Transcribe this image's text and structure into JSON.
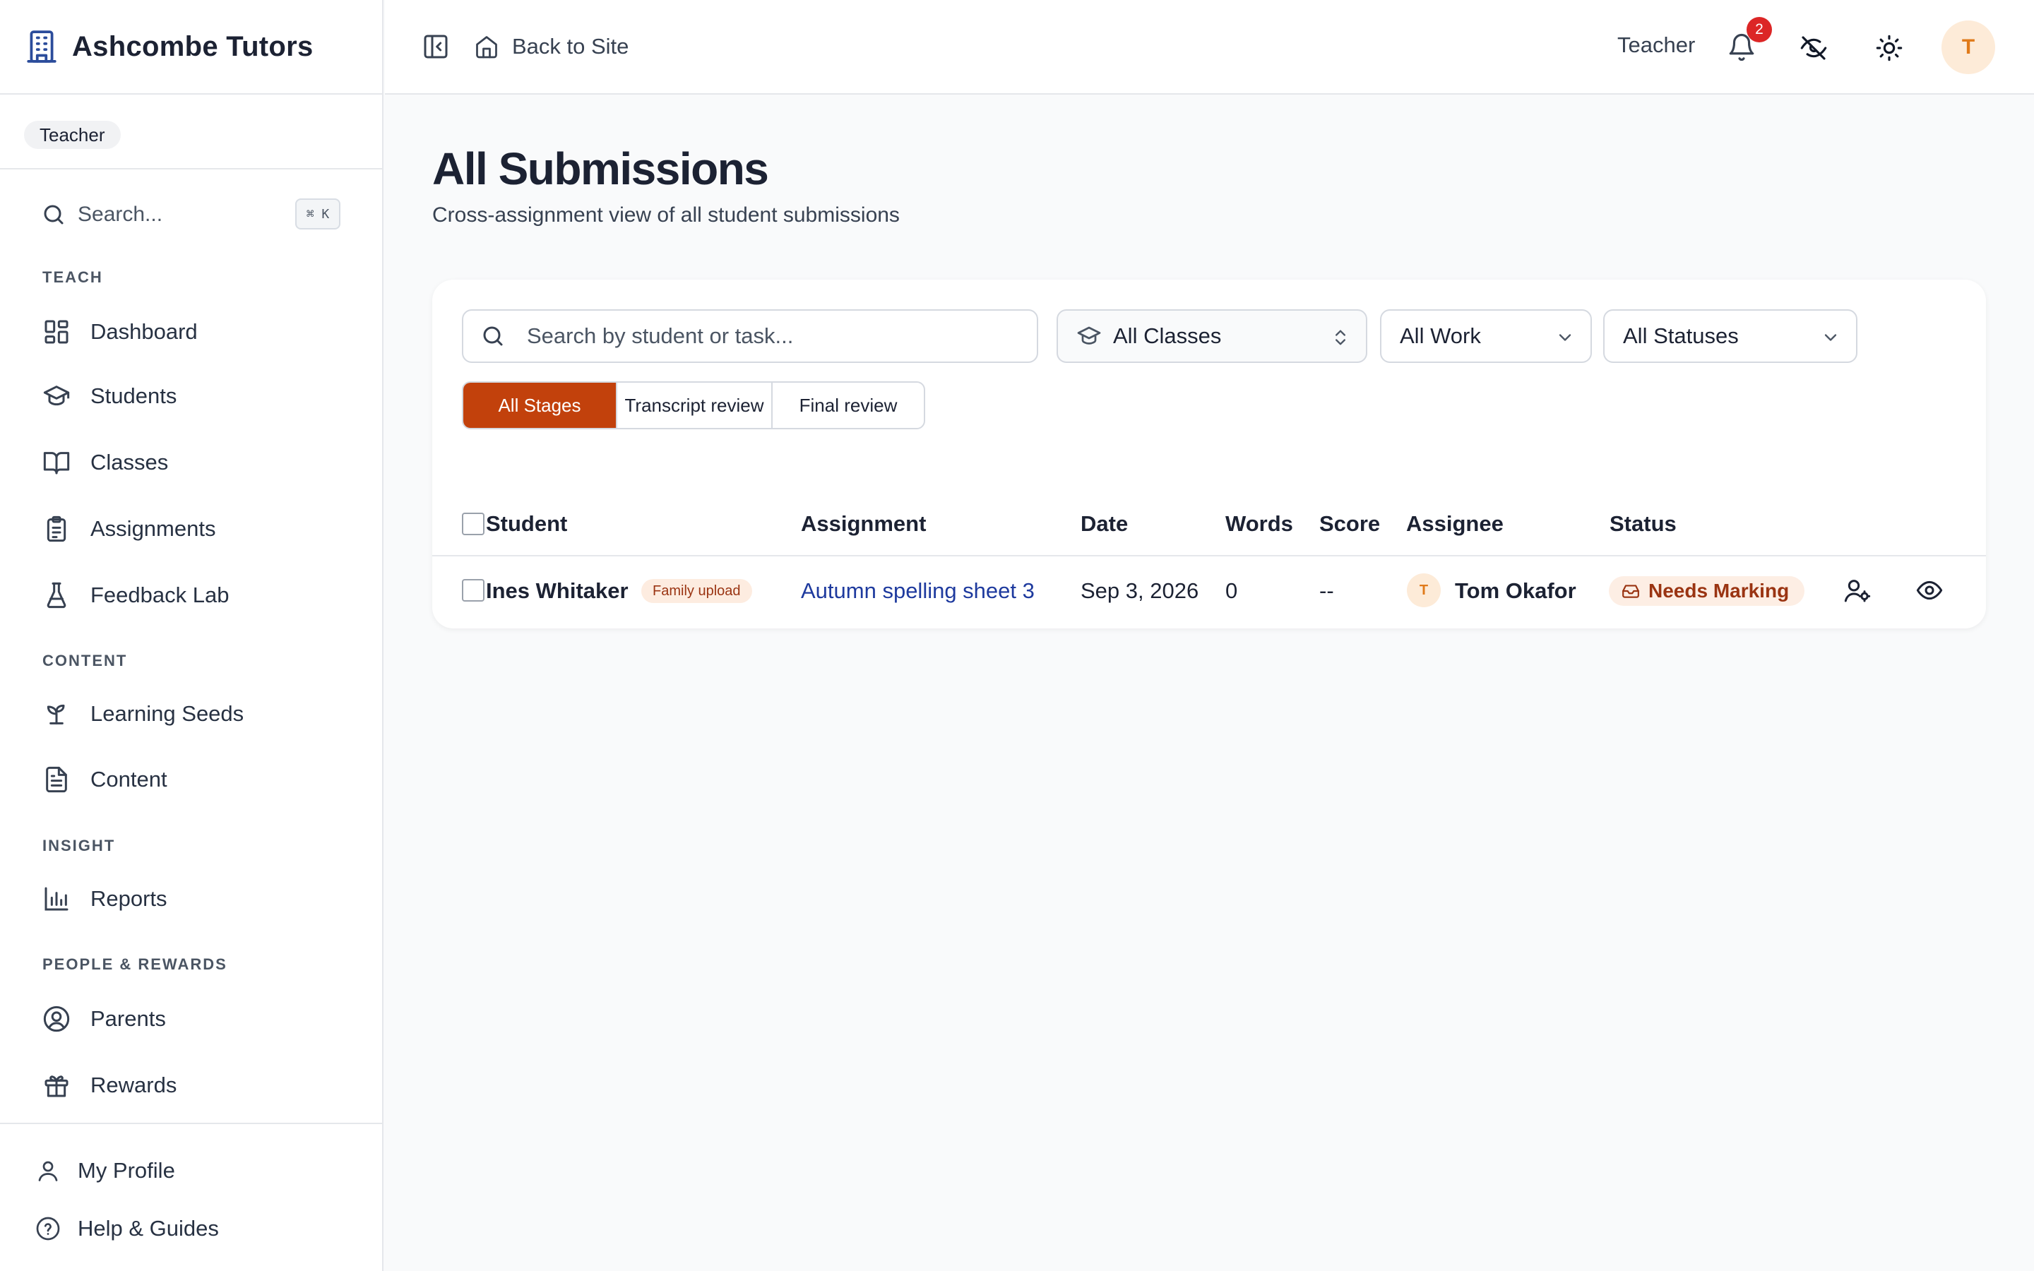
{
  "brand": {
    "name": "Ashcombe Tutors",
    "icon": "building-icon"
  },
  "sidebar": {
    "role_chip": "Teacher",
    "search": {
      "placeholder": "Search...",
      "shortcut": "⌘ K"
    },
    "sections": [
      {
        "label": "TEACH",
        "items": [
          {
            "label": "Dashboard",
            "icon": "dashboard-icon"
          },
          {
            "label": "Students",
            "icon": "graduation-cap-icon"
          },
          {
            "label": "Classes",
            "icon": "book-open-icon"
          },
          {
            "label": "Assignments",
            "icon": "clipboard-list-icon"
          },
          {
            "label": "Feedback Lab",
            "icon": "flask-icon"
          }
        ]
      },
      {
        "label": "CONTENT",
        "items": [
          {
            "label": "Learning Seeds",
            "icon": "sprout-icon"
          },
          {
            "label": "Content",
            "icon": "file-text-icon"
          }
        ]
      },
      {
        "label": "INSIGHT",
        "items": [
          {
            "label": "Reports",
            "icon": "bar-chart-icon"
          }
        ]
      },
      {
        "label": "PEOPLE & REWARDS",
        "items": [
          {
            "label": "Parents",
            "icon": "user-circle-icon"
          },
          {
            "label": "Rewards",
            "icon": "gift-icon"
          }
        ]
      }
    ],
    "bottom": [
      {
        "label": "My Profile",
        "icon": "user-icon"
      },
      {
        "label": "Help & Guides",
        "icon": "help-circle-icon"
      }
    ]
  },
  "header": {
    "back_label": "Back to Site",
    "role": "Teacher",
    "notification_count": "2",
    "avatar_initial": "T"
  },
  "page": {
    "title": "All Submissions",
    "subtitle": "Cross-assignment view of all student submissions"
  },
  "filters": {
    "search_placeholder": "Search by student or task...",
    "class_select": "All Classes",
    "work_select": "All Work",
    "status_select": "All Statuses",
    "stages": [
      "All Stages",
      "Transcript review",
      "Final review"
    ],
    "active_stage": "All Stages"
  },
  "table": {
    "columns": [
      "Student",
      "Assignment",
      "Date",
      "Words",
      "Score",
      "Assignee",
      "Status"
    ],
    "rows": [
      {
        "student": "Ines Whitaker",
        "tag": "Family upload",
        "assignment": "Autumn spelling sheet 3",
        "date": "Sep 3, 2026",
        "words": "0",
        "score": "--",
        "assignee_initial": "T",
        "assignee": "Tom Okafor",
        "status": "Needs Marking"
      }
    ]
  },
  "colors": {
    "accent": "#c2410c",
    "brand": "#2b4c9b",
    "link": "#1e3a9e",
    "badge": "#dc2626"
  }
}
